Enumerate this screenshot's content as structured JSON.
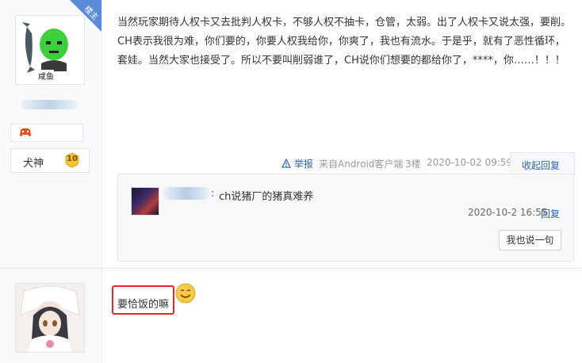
{
  "post1": {
    "badge": "楼主",
    "avatar_caption": "咸鱼",
    "rank_title": "犬神",
    "level": "10",
    "content": "当然玩家期待人权卡又去批判人权卡，不够人权不抽卡，仓管，太弱。出了人权卡又说太强，要削。CH表示我很为难，你们要的，你要人权我给你，你爽了，我也有流水。于是乎，就有了恶性循环，套娃。当然大家也接受了。所以不要叫削弱谁了，CH说你们想要的都给你了，****，你……！！！",
    "meta": {
      "report": "举报",
      "source": "来自Android客户端",
      "floor": "3楼",
      "time": "2020-10-02 09:59"
    },
    "collapse_reply": "收起回复"
  },
  "reply": {
    "colon": ":",
    "text": "ch说猪厂的猪真难养",
    "time": "2020-10-2 16:55",
    "reply_link": "回复",
    "say_button": "我也说一句"
  },
  "post2": {
    "content": "要恰饭的嘛"
  },
  "colors": {
    "link": "#2d64b3",
    "highlight_box": "#e6262a",
    "badge_blue": "#5b8bd8",
    "sidebar_bg": "#f7f9fb"
  }
}
